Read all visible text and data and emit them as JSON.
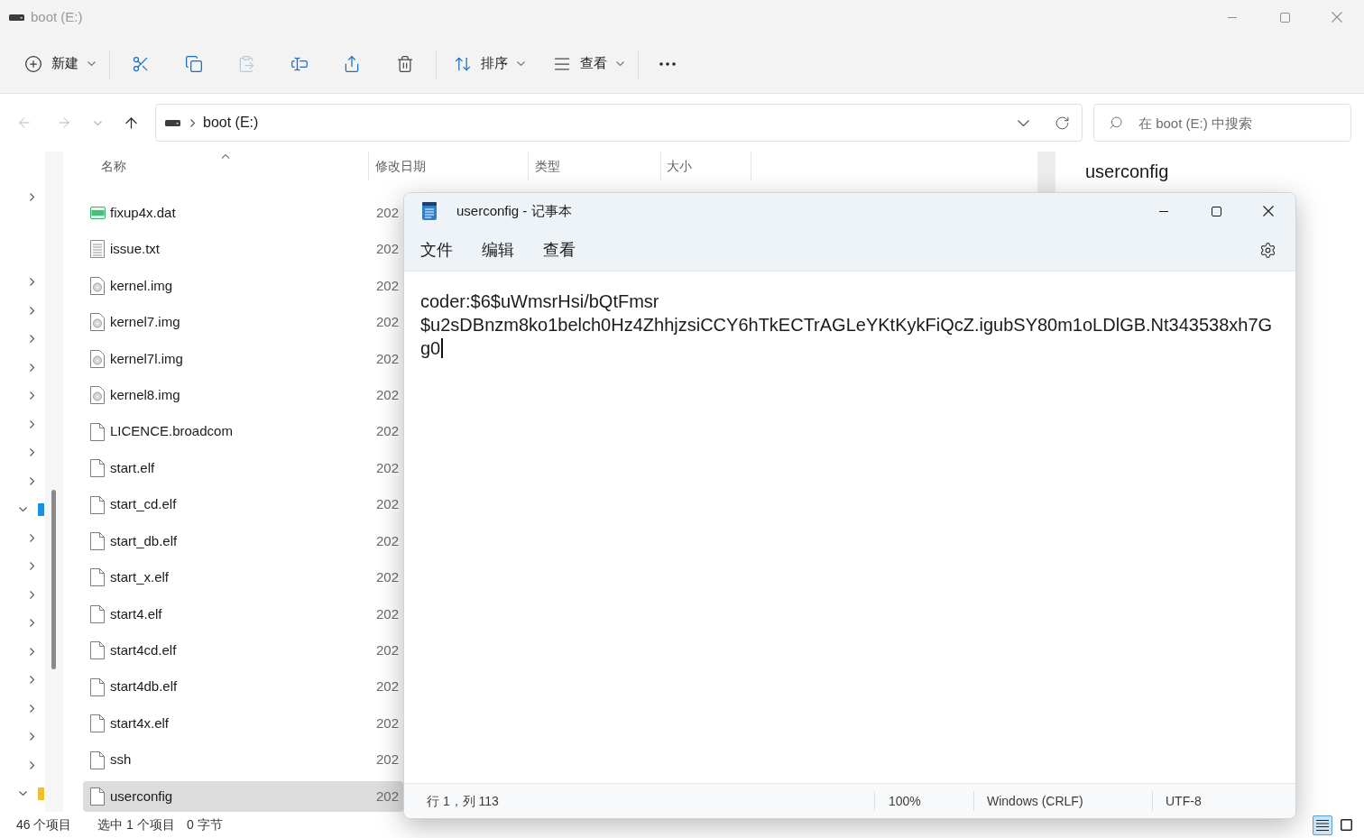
{
  "explorer": {
    "title": "boot (E:)",
    "active": false,
    "toolbar": [
      {
        "items": [
          {
            "kind": "new",
            "label": "新建",
            "dropdown": true,
            "disabled": false
          }
        ]
      },
      {
        "items": [
          {
            "kind": "cut",
            "dropdown": false,
            "disabled": false
          },
          {
            "kind": "copy",
            "dropdown": false,
            "disabled": false
          },
          {
            "kind": "paste",
            "dropdown": false,
            "disabled": true
          },
          {
            "kind": "rename",
            "dropdown": false,
            "disabled": false
          },
          {
            "kind": "share",
            "dropdown": false,
            "disabled": false
          },
          {
            "kind": "delete",
            "dropdown": false,
            "disabled": false
          }
        ]
      },
      {
        "items": [
          {
            "kind": "sort",
            "label": "排序",
            "dropdown": true,
            "disabled": false
          },
          {
            "kind": "view",
            "label": "查看",
            "dropdown": true,
            "disabled": false
          }
        ]
      },
      {
        "items": [
          {
            "kind": "more",
            "dropdown": false,
            "disabled": false
          }
        ]
      }
    ],
    "nav_buttons": [
      {
        "kind": "back",
        "disabled": true
      },
      {
        "kind": "forward",
        "disabled": true
      },
      {
        "kind": "recent",
        "disabled": true
      },
      {
        "kind": "up",
        "disabled": false
      }
    ],
    "address": {
      "path": "boot (E:)"
    },
    "search": {
      "placeholder": "在 boot (E:) 中搜索"
    },
    "nav_tree": [
      {
        "children": [
          {
            "expandable": true,
            "expanded": false
          },
          {
            "expandable": false
          },
          {
            "expandable": false
          },
          {
            "expandable": true,
            "expanded": false
          },
          {
            "expandable": true,
            "expanded": false
          },
          {
            "expandable": true,
            "expanded": false
          },
          {
            "expandable": true,
            "expanded": false
          },
          {
            "expandable": true,
            "expanded": false
          },
          {
            "expandable": true,
            "expanded": false
          },
          {
            "expandable": true,
            "expanded": false
          },
          {
            "expandable": true,
            "expanded": false
          }
        ]
      },
      {
        "expandable": true,
        "expanded": true,
        "color": "#1d8fe0",
        "children": [
          {
            "expandable": true,
            "expanded": false
          },
          {
            "expandable": true,
            "expanded": false
          },
          {
            "expandable": true,
            "expanded": false
          },
          {
            "expandable": true,
            "expanded": false
          },
          {
            "expandable": true,
            "expanded": false
          },
          {
            "expandable": true,
            "expanded": false
          },
          {
            "expandable": true,
            "expanded": false
          },
          {
            "expandable": true,
            "expanded": false
          },
          {
            "expandable": true,
            "expanded": false
          }
        ]
      },
      {
        "expandable": true,
        "expanded": true,
        "color": "#f0c02c"
      }
    ],
    "columns": [
      {
        "label": "名称",
        "sorted": true
      },
      {
        "label": "修改日期",
        "sorted": false
      },
      {
        "label": "类型",
        "sorted": false
      },
      {
        "label": "大小",
        "sorted": false
      }
    ],
    "files": [
      {
        "name": "fixup4x.dat",
        "kind": "data",
        "modified": "202",
        "selected": false
      },
      {
        "name": "issue.txt",
        "kind": "text",
        "modified": "202",
        "selected": false
      },
      {
        "name": "kernel.img",
        "kind": "image",
        "modified": "202",
        "selected": false
      },
      {
        "name": "kernel7.img",
        "kind": "image",
        "modified": "202",
        "selected": false
      },
      {
        "name": "kernel7l.img",
        "kind": "image",
        "modified": "202",
        "selected": false
      },
      {
        "name": "kernel8.img",
        "kind": "image",
        "modified": "202",
        "selected": false
      },
      {
        "name": "LICENCE.broadcom",
        "kind": "blank",
        "modified": "202",
        "selected": false
      },
      {
        "name": "start.elf",
        "kind": "blank",
        "modified": "202",
        "selected": false
      },
      {
        "name": "start_cd.elf",
        "kind": "blank",
        "modified": "202",
        "selected": false
      },
      {
        "name": "start_db.elf",
        "kind": "blank",
        "modified": "202",
        "selected": false
      },
      {
        "name": "start_x.elf",
        "kind": "blank",
        "modified": "202",
        "selected": false
      },
      {
        "name": "start4.elf",
        "kind": "blank",
        "modified": "202",
        "selected": false
      },
      {
        "name": "start4cd.elf",
        "kind": "blank",
        "modified": "202",
        "selected": false
      },
      {
        "name": "start4db.elf",
        "kind": "blank",
        "modified": "202",
        "selected": false
      },
      {
        "name": "start4x.elf",
        "kind": "blank",
        "modified": "202",
        "selected": false
      },
      {
        "name": "ssh",
        "kind": "blank",
        "modified": "202",
        "selected": false
      },
      {
        "name": "userconfig",
        "kind": "blank",
        "modified": "202",
        "selected": true
      }
    ],
    "preview": {
      "title": "userconfig"
    },
    "status_bar": {
      "item_count": "46 个项目",
      "selection": "选中 1 个项目",
      "selection_size": "0 字节"
    },
    "view_buttons": [
      {
        "kind": "details",
        "selected": true
      },
      {
        "kind": "preview",
        "selected": false
      }
    ]
  },
  "notepad": {
    "title": "userconfig - 记事本",
    "active": true,
    "menu": [
      "文件",
      "编辑",
      "查看"
    ],
    "lines": [
      "coder:$6$uWmsrHsi/bQtFmsr",
      "$u2sDBnzm8ko1belch0Hz4ZhhjzsiCCY6hTkECTrAGLeYKtKykFiQcZ.igubSY80m1oLDlGB.Nt343538xh7G",
      "g0"
    ],
    "status": [
      "行 1，列 113",
      "100%",
      "Windows (CRLF)",
      "UTF-8"
    ]
  }
}
